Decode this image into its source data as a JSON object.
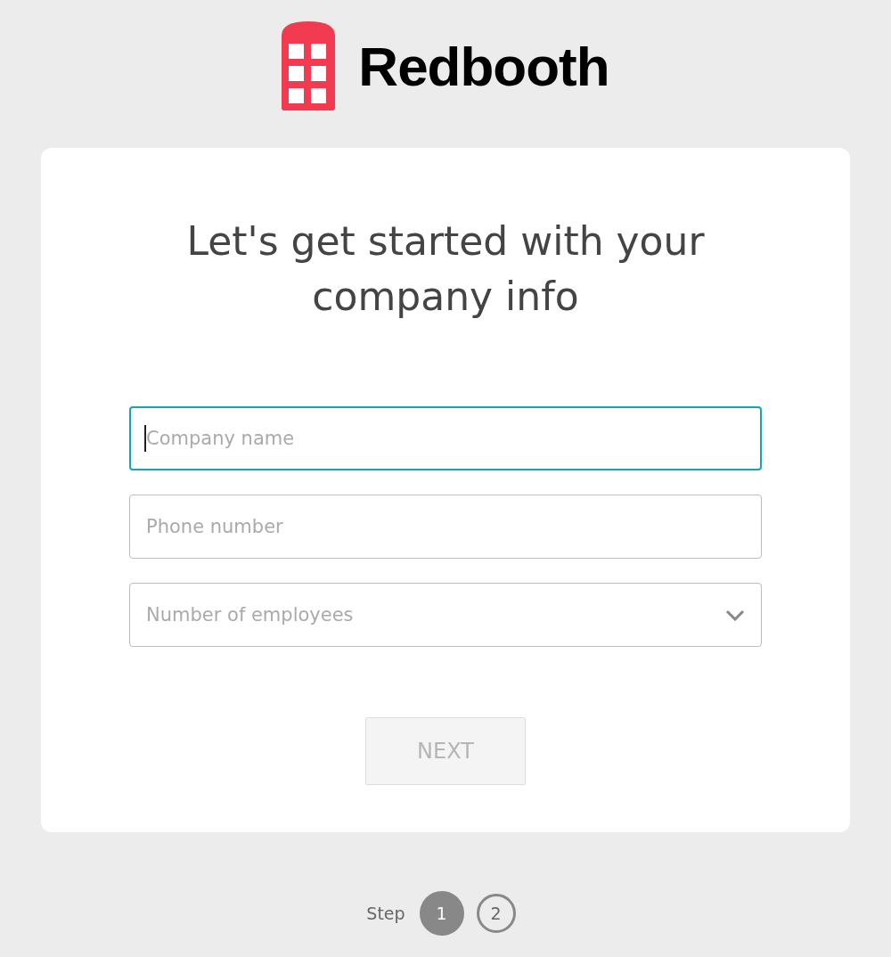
{
  "brand": {
    "name": "Redbooth"
  },
  "heading": "Let's get started with your company info",
  "fields": [
    {
      "kind": "text",
      "placeholder": "Company name",
      "focused": true
    },
    {
      "kind": "text",
      "placeholder": "Phone number",
      "focused": false
    },
    {
      "kind": "select",
      "placeholder": "Number of employees",
      "focused": false
    }
  ],
  "next_button": {
    "label": "NEXT",
    "disabled": true
  },
  "steps": {
    "label": "Step",
    "items": [
      {
        "label": "1",
        "selected": true
      },
      {
        "label": "2",
        "selected": false
      }
    ]
  }
}
